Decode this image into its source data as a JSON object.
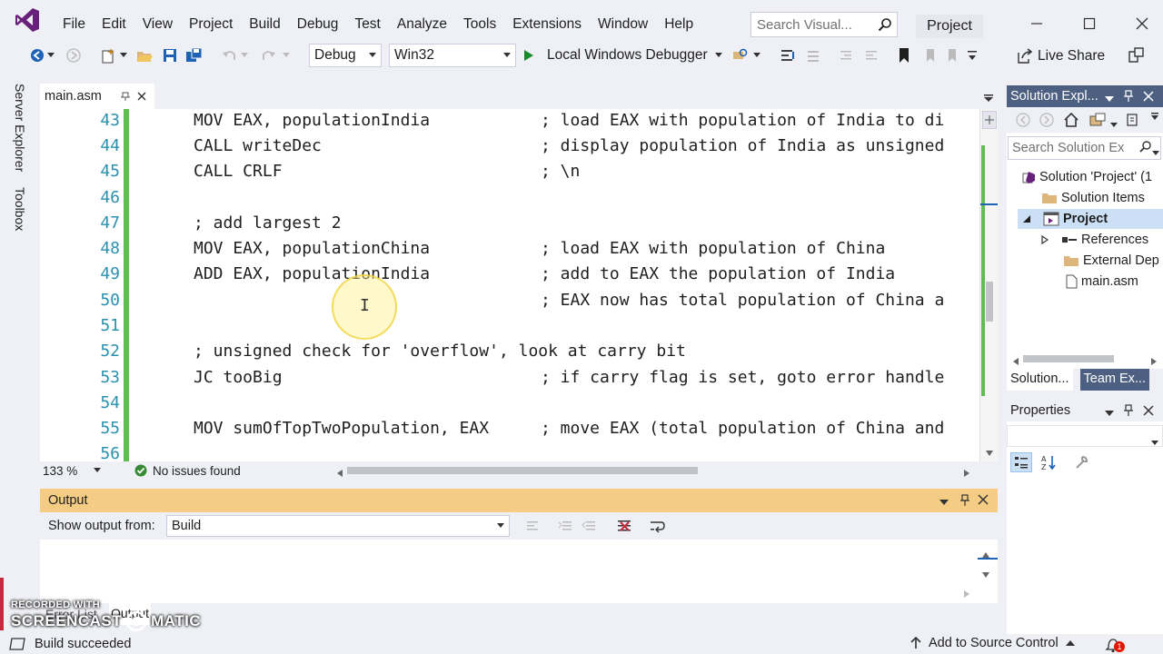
{
  "menu": [
    "File",
    "Edit",
    "View",
    "Project",
    "Build",
    "Debug",
    "Test",
    "Analyze",
    "Tools",
    "Extensions",
    "Window",
    "Help"
  ],
  "search": {
    "placeholder": "Search Visual..."
  },
  "project_badge": "Project",
  "toolbar": {
    "config": "Debug",
    "platform": "Win32",
    "debugger_label": "Local Windows Debugger",
    "live_share": "Live Share"
  },
  "left_tabs": {
    "server_explorer": "Server Explorer",
    "toolbox": "Toolbox"
  },
  "editor": {
    "tab_name": "main.asm",
    "zoom": "133 %",
    "issues": "No issues found",
    "lines": [
      {
        "n": "43",
        "code": "MOV EAX, populationIndia",
        "comment": "; load EAX with population of India to di"
      },
      {
        "n": "44",
        "code": "CALL writeDec",
        "comment": "; display population of India as unsigned"
      },
      {
        "n": "45",
        "code": "CALL CRLF",
        "comment": "; \\n"
      },
      {
        "n": "46",
        "code": "",
        "comment": ""
      },
      {
        "n": "47",
        "code": "; add largest 2",
        "comment": ""
      },
      {
        "n": "48",
        "code": "MOV EAX, populationChina",
        "comment": "; load EAX with population of China"
      },
      {
        "n": "49",
        "code": "ADD EAX, populationIndia",
        "comment": "; add to EAX the population of India"
      },
      {
        "n": "50",
        "code": "",
        "comment": "; EAX now has total population of China a"
      },
      {
        "n": "51",
        "code": "",
        "comment": ""
      },
      {
        "n": "52",
        "code": "; unsigned check for 'overflow', look at carry bit",
        "comment": ""
      },
      {
        "n": "53",
        "code": "JC tooBig",
        "comment": "; if carry flag is set, goto error handle"
      },
      {
        "n": "54",
        "code": "",
        "comment": ""
      },
      {
        "n": "55",
        "code": "MOV sumOfTopTwoPopulation, EAX",
        "comment": "; move EAX (total population of China and"
      },
      {
        "n": "56",
        "code": "",
        "comment": ""
      }
    ]
  },
  "output": {
    "title": "Output",
    "show_from_label": "Show output from:",
    "source": "Build"
  },
  "bottom_tabs": {
    "error_list": "Error List",
    "output": "Output"
  },
  "solution_explorer": {
    "title": "Solution Expl...",
    "search_placeholder": "Search Solution Ex",
    "tree": [
      "Solution 'Project' (1",
      "Solution Items",
      "Project",
      "References",
      "External Dep",
      "main.asm"
    ],
    "tabs": [
      "Solution...",
      "Team Ex..."
    ]
  },
  "properties": {
    "title": "Properties"
  },
  "status": {
    "message": "Build succeeded",
    "source_control": "Add to Source Control",
    "notifications": "1"
  },
  "watermark": {
    "line1": "RECORDED WITH",
    "line2a": "SCREENCAST",
    "line2b": "MATIC"
  },
  "colors": {
    "accent_purple": "#68217a",
    "line_number": "#2b91af",
    "change_bar": "#5fbf52",
    "output_header": "#f5cc84",
    "panel_header_active": "#4d6082",
    "play_green": "#1a8a2a",
    "badge_red": "#e51400"
  }
}
